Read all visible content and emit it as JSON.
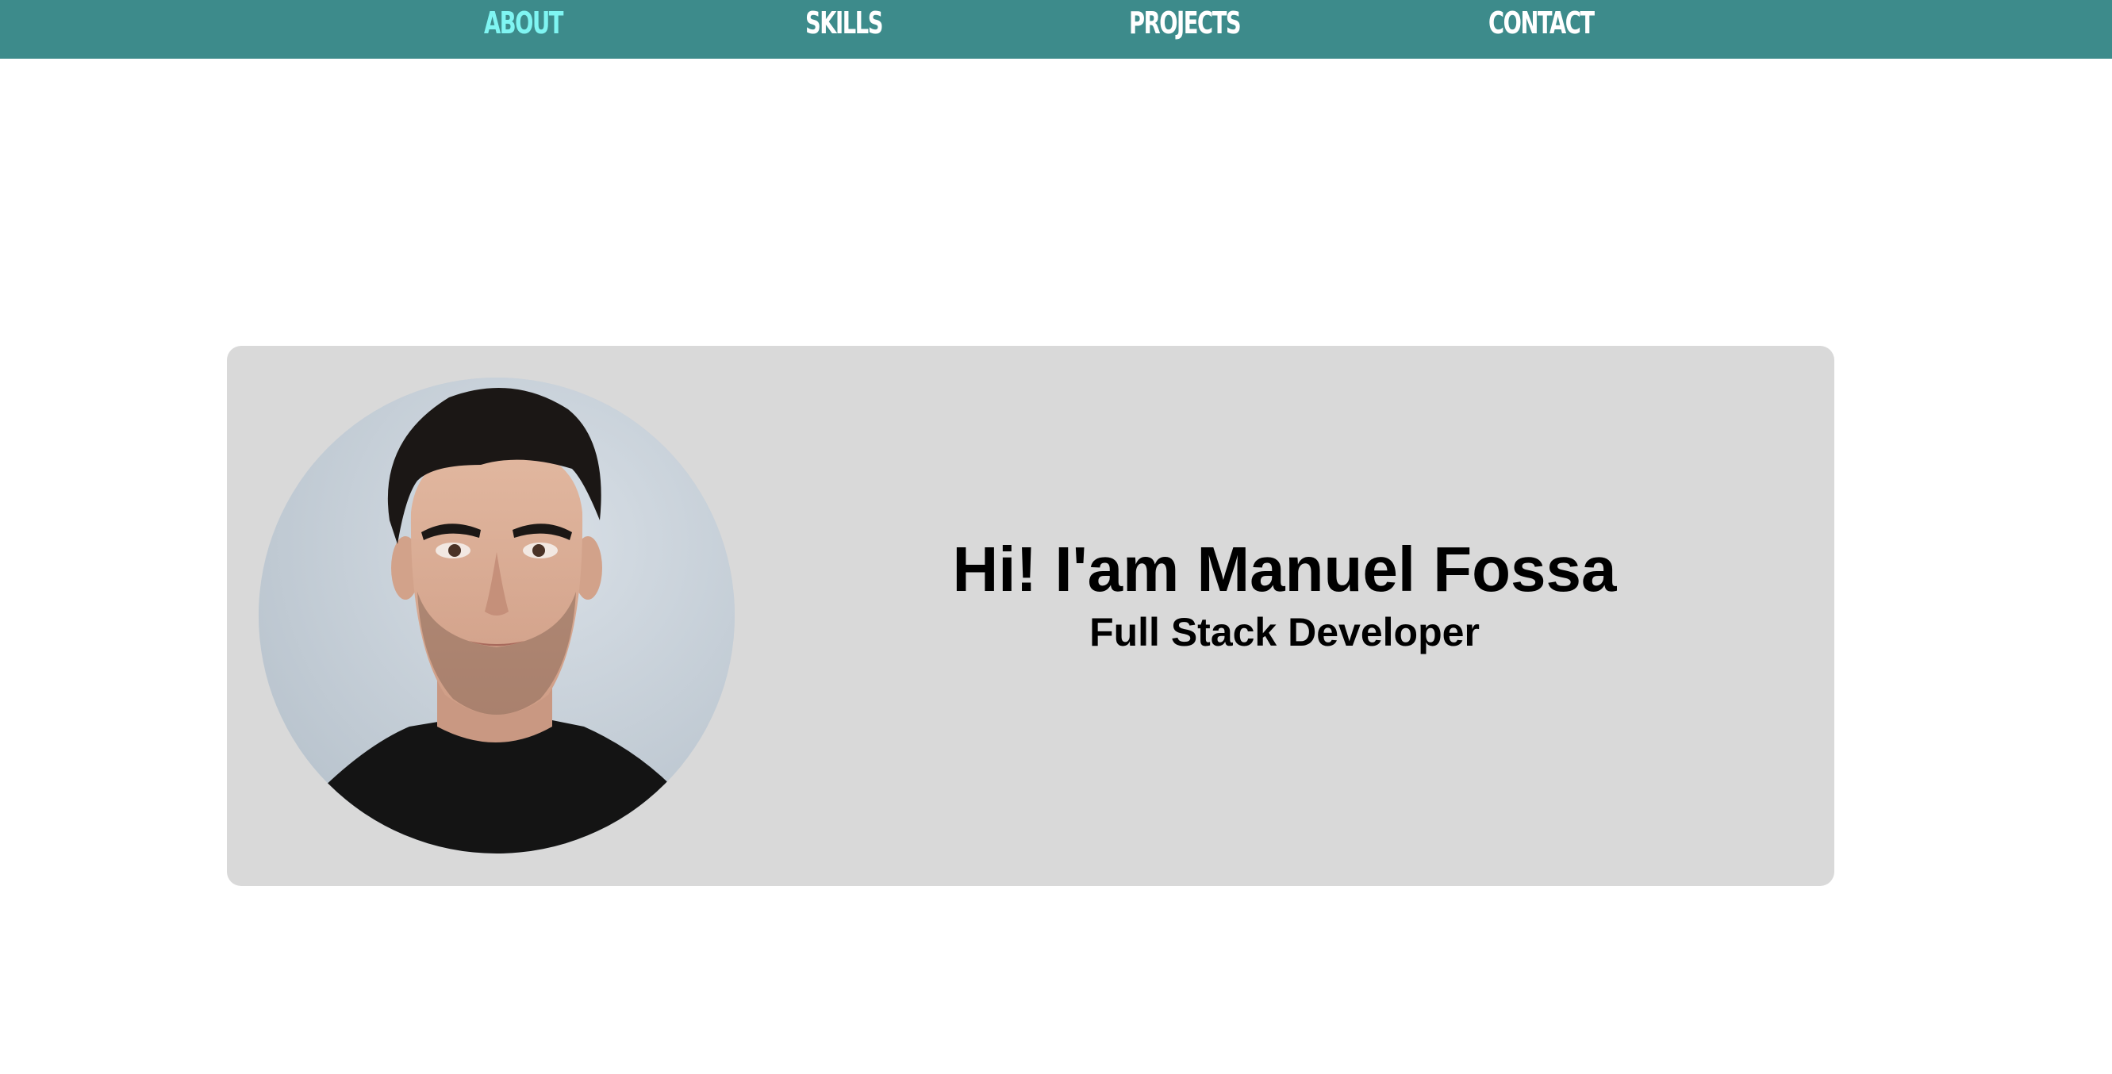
{
  "nav": {
    "items": [
      {
        "label": "ABOUT",
        "active": true
      },
      {
        "label": "SKILLS",
        "active": false
      },
      {
        "label": "PROJECTS",
        "active": false
      },
      {
        "label": "CONTACT",
        "active": false
      }
    ],
    "background_color": "#3d8b8b",
    "active_color": "#7ff5f2",
    "text_color": "#ffffff"
  },
  "hero": {
    "title": "Hi! I'am Manuel Fossa",
    "subtitle": "Full Stack Developer",
    "avatar_icon": "profile-photo",
    "card_color": "#d9d9d9"
  }
}
